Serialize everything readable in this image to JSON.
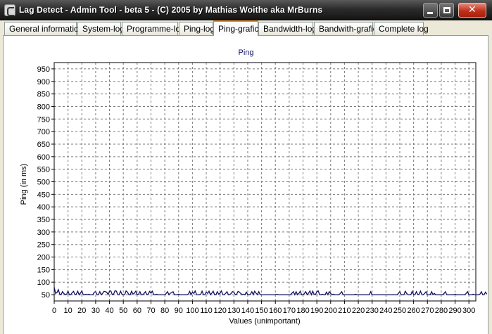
{
  "window": {
    "title": "Lag Detect - Admin Tool - beta 5 - (C) 2005 by Mathias Woithe aka MrBurns",
    "controls": {
      "minimize": "minimize",
      "maximize": "maximize",
      "close": "close"
    }
  },
  "tabs": [
    {
      "label": "General information"
    },
    {
      "label": "System-log"
    },
    {
      "label": "Programme-log"
    },
    {
      "label": "Ping-log"
    },
    {
      "label": "Ping-grafic",
      "active": true
    },
    {
      "label": "Bandwidth-log"
    },
    {
      "label": "Bandwith-grafic"
    },
    {
      "label": "Complete log"
    }
  ],
  "chart_data": {
    "type": "line",
    "title": "Ping",
    "xlabel": "Values (unimportant)",
    "ylabel": "Ping (in ms)",
    "xlim": [
      0,
      305
    ],
    "ylim": [
      25,
      975
    ],
    "xticks": [
      0,
      10,
      20,
      30,
      40,
      50,
      60,
      70,
      80,
      90,
      100,
      110,
      120,
      130,
      140,
      150,
      160,
      170,
      180,
      190,
      200,
      210,
      220,
      230,
      240,
      250,
      260,
      270,
      280,
      290,
      300
    ],
    "yticks": [
      50,
      100,
      150,
      200,
      250,
      300,
      350,
      400,
      450,
      500,
      550,
      600,
      650,
      700,
      750,
      800,
      850,
      900,
      950
    ],
    "grid": true,
    "line_color": "#101060",
    "series": [
      {
        "values": [
          80,
          55,
          58,
          70,
          52,
          50,
          62,
          55,
          50,
          52,
          64,
          50,
          50,
          58,
          63,
          50,
          52,
          64,
          50,
          56,
          65,
          50,
          50,
          52,
          50,
          52,
          50,
          50,
          50,
          60,
          62,
          50,
          50,
          62,
          50,
          55,
          63,
          62,
          60,
          50,
          64,
          65,
          50,
          52,
          66,
          64,
          50,
          50,
          64,
          52,
          50,
          50,
          65,
          60,
          50,
          50,
          64,
          52,
          56,
          64,
          50,
          52,
          62,
          50,
          50,
          55,
          62,
          50,
          52,
          63,
          56,
          64,
          50,
          50,
          52,
          50,
          50,
          50,
          50,
          50,
          50,
          55,
          62,
          50,
          56,
          58,
          62,
          50,
          50,
          50,
          52,
          50,
          50,
          50,
          50,
          50,
          50,
          52,
          63,
          50,
          60,
          55,
          65,
          50,
          50,
          50,
          52,
          64,
          50,
          50,
          60,
          55,
          64,
          50,
          56,
          64,
          50,
          50,
          62,
          52,
          56,
          65,
          50,
          50,
          55,
          62,
          50,
          50,
          55,
          62,
          60,
          50,
          52,
          63,
          60,
          55,
          50,
          52,
          50,
          60,
          50,
          50,
          52,
          62,
          50,
          64,
          56,
          50,
          62,
          50,
          50,
          50,
          50,
          50,
          50,
          50,
          50,
          50,
          50,
          50,
          50,
          52,
          50,
          50,
          50,
          50,
          50,
          50,
          50,
          50,
          50,
          50,
          56,
          62,
          50,
          62,
          50,
          55,
          64,
          50,
          50,
          55,
          62,
          50,
          56,
          65,
          50,
          64,
          52,
          50,
          62,
          65,
          50,
          50,
          52,
          50,
          50,
          60,
          50,
          62,
          55,
          50,
          52,
          50,
          50,
          50,
          50,
          55,
          62,
          50,
          50,
          50,
          50,
          50,
          50,
          50,
          50,
          50,
          52,
          50,
          50,
          50,
          50,
          50,
          50,
          50,
          50,
          50,
          50,
          62,
          50,
          50,
          50,
          50,
          50,
          50,
          50,
          50,
          50,
          50,
          50,
          50,
          50,
          50,
          50,
          50,
          50,
          50,
          50,
          55,
          62,
          50,
          50,
          50,
          64,
          55,
          50,
          50,
          50,
          64,
          50,
          50,
          62,
          50,
          52,
          64,
          50,
          50,
          55,
          62,
          50,
          50,
          50,
          62,
          50,
          55,
          50,
          50,
          50,
          50,
          50,
          50,
          55,
          62,
          50,
          50,
          50,
          50,
          50,
          50,
          52,
          50,
          50,
          50,
          50,
          50,
          50,
          50,
          55,
          62,
          50,
          50,
          50,
          52,
          50,
          50,
          50,
          50,
          52,
          62,
          50,
          50,
          60,
          52
        ]
      }
    ]
  }
}
